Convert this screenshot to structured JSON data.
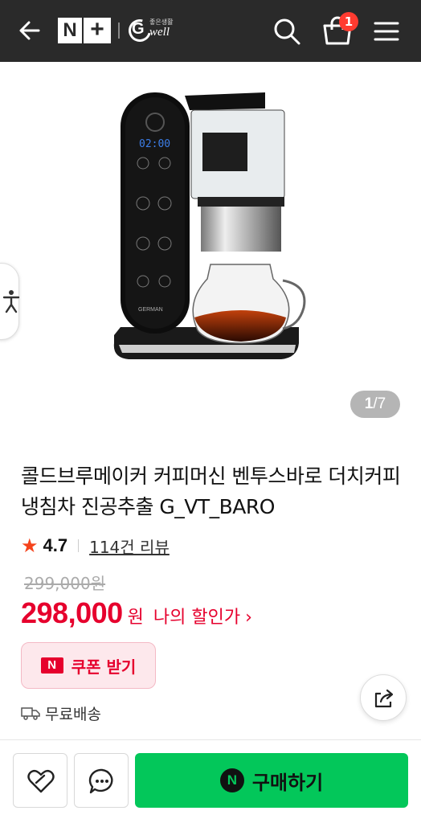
{
  "header": {
    "logo_n": "N",
    "logo_plus": "+",
    "brand_top": "좋은생활",
    "brand_g": "G",
    "brand_word": "well",
    "cart_count": "1",
    "icons": [
      "back-arrow-icon",
      "search-icon",
      "cart-icon",
      "menu-icon"
    ]
  },
  "gallery": {
    "current": "1",
    "separator": "/",
    "total": "7",
    "image_brand_text": "GERMAN",
    "image_display_text": "02:00"
  },
  "product": {
    "title": "콜드브루메이커 커피머신 벤투스바로 더치커피 냉침차 진공추출 G_VT_BARO",
    "rating": "4.7",
    "review_link": "114건 리뷰",
    "original_price": "299,000원",
    "price": "298,000",
    "currency": "원",
    "my_discount": "나의 할인가",
    "chevron": "›"
  },
  "coupon": {
    "icon": "N",
    "label": "쿠폰 받기"
  },
  "shipping": {
    "label": "무료배송"
  },
  "bottom_bar": {
    "buy_icon": "N",
    "buy_label": "구매하기"
  },
  "colors": {
    "header_bg": "#2a2a2a",
    "price_red": "#e6002d",
    "buy_green": "#03c75a",
    "badge_red": "#ff3b30",
    "star_orange": "#f5431c"
  }
}
